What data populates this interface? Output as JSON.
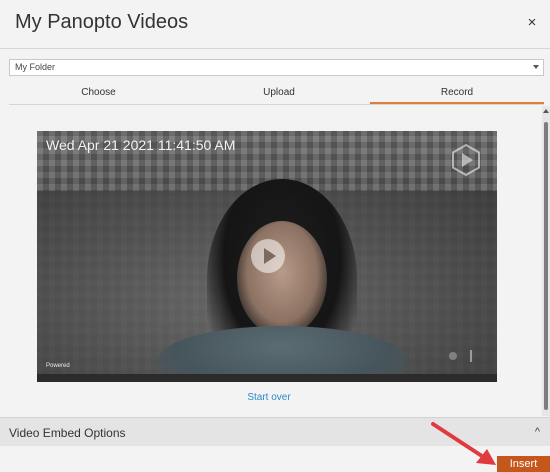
{
  "dialog": {
    "title": "My Panopto Videos",
    "close_glyph": "×"
  },
  "folder": {
    "selected": "My Folder"
  },
  "tabs": [
    {
      "label": "Choose",
      "active": false
    },
    {
      "label": "Upload",
      "active": false
    },
    {
      "label": "Record",
      "active": true
    }
  ],
  "video": {
    "timestamp": "Wed Apr 21 2021 11:41:50 AM",
    "powered_label": "Powered",
    "logo_icon": "panopto-play-logo-icon",
    "play_icon": "play-icon"
  },
  "actions": {
    "start_over": "Start over",
    "insert": "Insert"
  },
  "embed_options": {
    "label": "Video Embed Options",
    "toggle_glyph": "^"
  },
  "colors": {
    "accent": "#e07b39",
    "insert_button": "#c5571d",
    "link": "#2a8ac8",
    "annotation_arrow": "#e0393e"
  }
}
